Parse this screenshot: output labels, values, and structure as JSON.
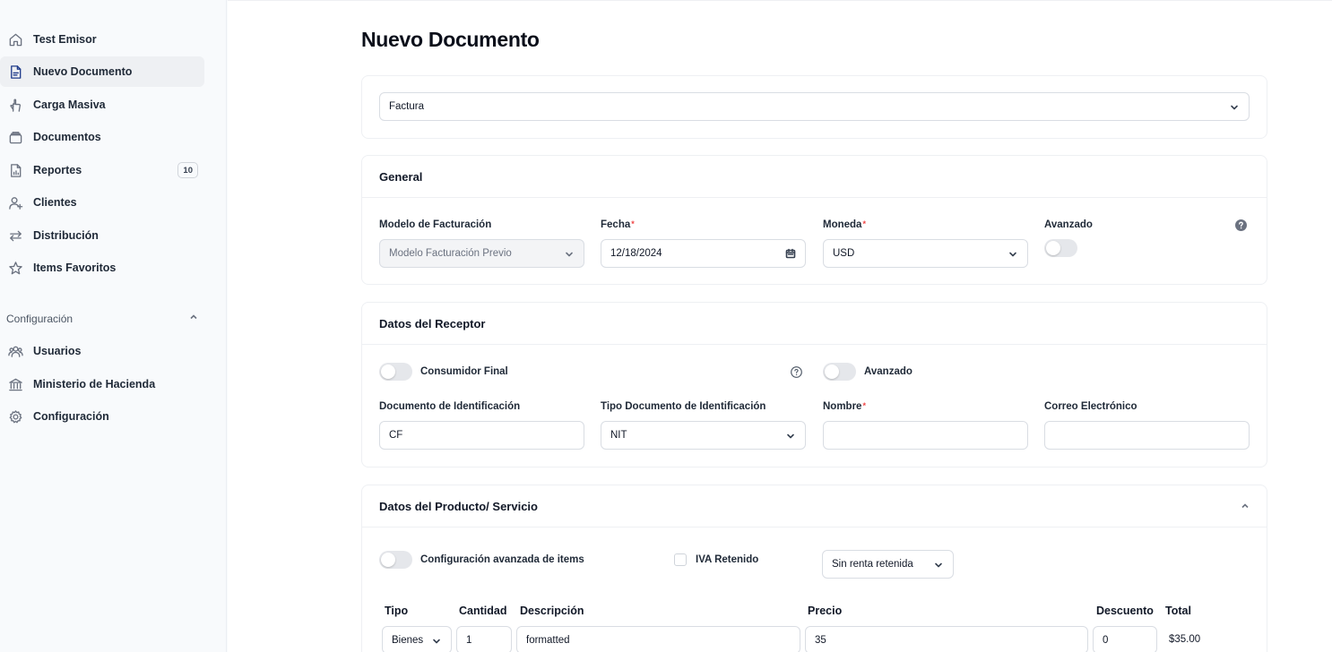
{
  "sidebar": {
    "items": [
      {
        "label": "Test Emisor",
        "icon": "home-icon"
      },
      {
        "label": "Nuevo Documento",
        "icon": "document-icon",
        "active": true
      },
      {
        "label": "Carga Masiva",
        "icon": "upload-hand-icon"
      },
      {
        "label": "Documentos",
        "icon": "archive-icon"
      },
      {
        "label": "Reportes",
        "icon": "report-icon",
        "badge": "10"
      },
      {
        "label": "Clientes",
        "icon": "user-add-icon"
      },
      {
        "label": "Distribución",
        "icon": "arrows-icon"
      },
      {
        "label": "Items Favoritos",
        "icon": "star-icon"
      }
    ],
    "config_section": {
      "label": "Configuración",
      "items": [
        {
          "label": "Usuarios",
          "icon": "users-icon"
        },
        {
          "label": "Ministerio de Hacienda",
          "icon": "bank-icon"
        },
        {
          "label": "Configuración",
          "icon": "gear-icon"
        }
      ]
    }
  },
  "main": {
    "title": "Nuevo Documento",
    "doc_type": {
      "value": "Factura"
    },
    "general": {
      "header": "General",
      "modelo_label": "Modelo de Facturación",
      "modelo_value": "Modelo Facturación Previo",
      "fecha_label": "Fecha",
      "fecha_value": "12/18/2024",
      "moneda_label": "Moneda",
      "moneda_value": "USD",
      "avanzado_label": "Avanzado",
      "required_mark": "*"
    },
    "receptor": {
      "header": "Datos del Receptor",
      "consumidor_label": "Consumidor Final",
      "avanzado_label": "Avanzado",
      "doc_id_label": "Documento de Identificación",
      "doc_id_value": "CF",
      "tipo_doc_label": "Tipo Documento de Identificación",
      "tipo_doc_value": "NIT",
      "nombre_label": "Nombre",
      "nombre_value": "",
      "correo_label": "Correo Electrónico",
      "correo_value": "",
      "required_mark": "*"
    },
    "producto": {
      "header": "Datos del Producto/ Servicio",
      "config_avanzada_label": "Configuración avanzada de items",
      "iva_label": "IVA Retenido",
      "renta_value": "Sin renta retenida",
      "columns": {
        "tipo": "Tipo",
        "cantidad": "Cantidad",
        "descripcion": "Descripción",
        "precio": "Precio",
        "descuento": "Descuento",
        "total": "Total"
      },
      "row": {
        "tipo": "Bienes",
        "cantidad": "1",
        "descripcion": "formatted",
        "precio": "35",
        "descuento": "0",
        "total": "$35.00"
      }
    }
  }
}
